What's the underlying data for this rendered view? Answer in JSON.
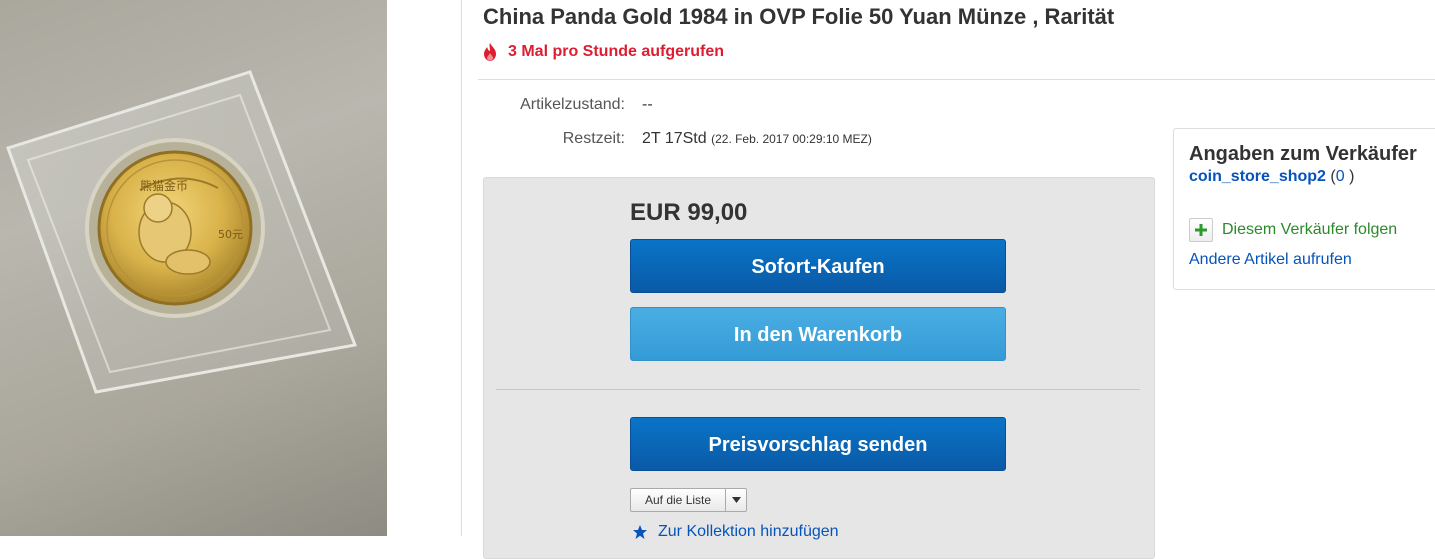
{
  "listing": {
    "title": "China Panda Gold 1984 in OVP Folie 50 Yuan Münze , Rarität",
    "watchers_text": "3 Mal pro Stunde aufgerufen",
    "condition_label": "Artikelzustand:",
    "condition_value": "--",
    "time_label": "Restzeit:",
    "time_left": "2T 17Std",
    "end_date": "(22. Feb. 2017  00:29:10 MEZ)"
  },
  "photo": {
    "coin_script": "熊猫金币",
    "coin_denom": "50元"
  },
  "buybox": {
    "price": "EUR 99,00",
    "buy_now_label": "Sofort-Kaufen",
    "add_to_cart_label": "In den Warenkorb",
    "make_offer_label": "Preisvorschlag senden",
    "watch_label": "Auf die Liste",
    "collection_label": "Zur Kollektion hinzufügen"
  },
  "seller": {
    "heading": "Angaben zum Verkäufer",
    "name": "coin_store_shop2",
    "paren_open": "(",
    "feedback_score": "0",
    "paren_close": ")",
    "follow_label": "Diesem Verkäufer folgen",
    "other_items_label": "Andere Artikel aufrufen"
  },
  "colors": {
    "watchers": "#dd1e31",
    "link": "#0654ba",
    "follow": "#2b8a2b",
    "button_dark": "#0a5aa6",
    "button_light": "#359bd6"
  },
  "icons": {
    "flame": "flame-icon",
    "plus": "plus-icon",
    "star": "star-icon",
    "dropdown": "chevron-down-icon"
  }
}
